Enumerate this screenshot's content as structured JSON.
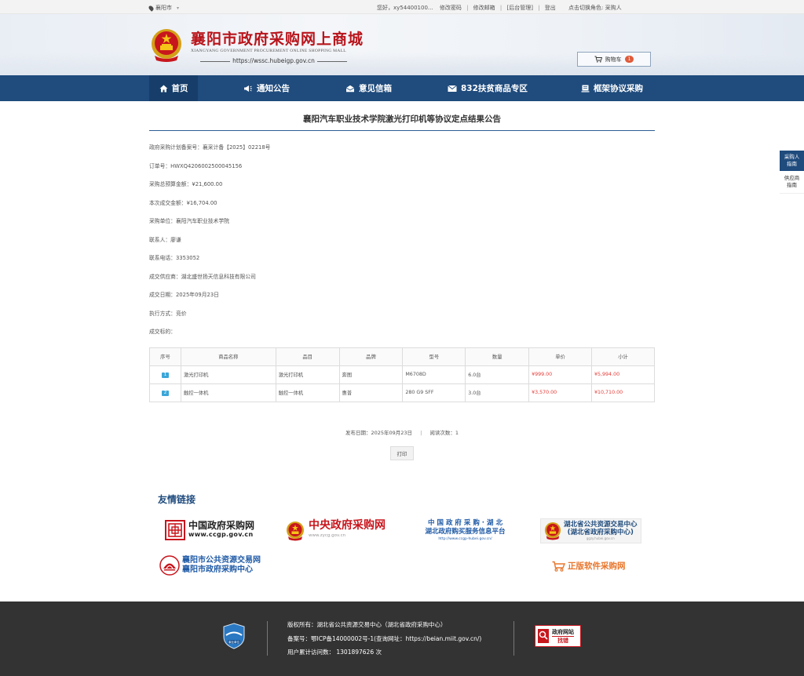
{
  "topbar": {
    "location": "襄阳市",
    "greeting": "您好，xy54400100...",
    "links": [
      "修改密码",
      "修改邮箱",
      "[后台管理]",
      "登出"
    ],
    "switch_role": "点击切换角色: 采购人"
  },
  "header": {
    "title": "襄阳市政府采购网上商城",
    "subtitle": "XIANGYANG GOVERNMENT PROCUREMENT ONLINE SHOPPING MALL",
    "url": "https://wssc.hubeigp.gov.cn",
    "cart_label": "购物车",
    "cart_count": "1"
  },
  "nav": [
    "首页",
    "通知公告",
    "意见信箱",
    "832扶贫商品专区",
    "框架协议采购"
  ],
  "doc": {
    "title": "襄阳汽车职业技术学院激光打印机等协议定点结果公告",
    "info": [
      "政府采购计划备案号：襄采计备【2025】02218号",
      "订单号：HWXQ4206002500045156",
      "采购总预算金额：¥21,600.00",
      "本次成交金额：¥16,704.00",
      "采购单位：襄阳汽车职业技术学院",
      "联系人：廖谦",
      "联系电话：3353052",
      "成交供应商：湖北盛世扬天信息科技有限公司",
      "成交日期：2025年09月23日",
      "执行方式：竞价",
      "成交标的："
    ],
    "table": {
      "headers": [
        "序号",
        "商品名称",
        "品目",
        "品牌",
        "型号",
        "数量",
        "单价",
        "小计"
      ],
      "rows": [
        [
          "1",
          "激光打印机",
          "激光打印机",
          "奔图",
          "M6708D",
          "6.0台",
          "¥999.00",
          "¥5,994.00"
        ],
        [
          "2",
          "触控一体机",
          "触控一体机",
          "惠普",
          "280 G9 SFF",
          "3.0台",
          "¥3,570.00",
          "¥10,710.00"
        ]
      ]
    },
    "publish_date": "发布日期：2025年09月23日",
    "read_count": "阅读次数：1",
    "print_label": "打印"
  },
  "links": {
    "title": "友情链接",
    "ccgp_cn": "中国政府采购网",
    "ccgp_url": "www.ccgp.gov.cn",
    "zycg_cn": "中央政府采购网",
    "zycg_url": "www.zycg.gov.cn",
    "hubei_line1": "中 国 政 府 采 购 · 湖 北",
    "hubei_line2": "湖北政府购买服务信息平台",
    "hubei_url": "http://www.ccgp-hubei.gov.cn/",
    "hbggzy_line1": "湖北省公共资源交易中心",
    "hbggzy_line2": "(湖北省政府采购中心)",
    "hbggzy_url": "ggzy.hubei.gov.cn",
    "xy_line1": "襄阳市公共资源交易网",
    "xy_line2": "襄阳市政府采购中心",
    "software": "正版软件采购网"
  },
  "side": {
    "buyer_guide": [
      "采购人",
      "指南"
    ],
    "supplier_guide": [
      "供应商",
      "指南"
    ]
  },
  "footer": {
    "copyright": "版权所有：湖北省公共资源交易中心（湖北省政府采购中心）",
    "icp": "备案号：鄂ICP备14000002号-1(查询网址：https://beian.miit.gov.cn/)",
    "visits": "用户累计访问数：  1301897626 次",
    "badge_label": "政府网站",
    "badge_sub": "找错",
    "gov_badge": "事业单位"
  }
}
